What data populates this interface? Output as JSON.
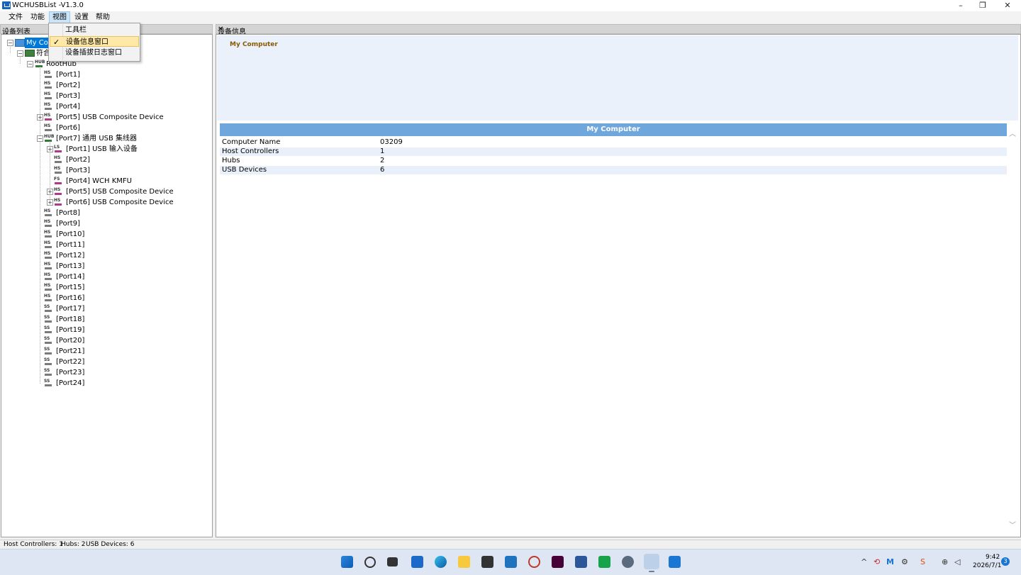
{
  "window": {
    "title": "WCHUSBList -V1.3.0"
  },
  "menu": {
    "items": [
      "文件",
      "功能",
      "视图",
      "设置",
      "帮助"
    ]
  },
  "view_menu": {
    "items": [
      {
        "label": "工具栏",
        "checked": false
      },
      {
        "label": "设备信息窗口",
        "checked": true
      },
      {
        "label": "设备插拔日志窗口",
        "checked": false
      }
    ]
  },
  "left_pane": {
    "title": "设备列表"
  },
  "tree": {
    "root": "My Com",
    "controller": "符合",
    "roothub": "RootHub",
    "ports": [
      "[Port1]",
      "[Port2]",
      "[Port3]",
      "[Port4]",
      "[Port5] USB Composite Device",
      "[Port6]",
      "[Port7] 通用 USB 集线器"
    ],
    "subports": [
      "[Port1] USB 输入设备",
      "[Port2]",
      "[Port3]",
      "[Port4] WCH KMFU",
      "[Port5] USB Composite Device",
      "[Port6] USB Composite Device"
    ],
    "more_ports": [
      "[Port8]",
      "[Port9]",
      "[Port10]",
      "[Port11]",
      "[Port12]",
      "[Port13]",
      "[Port14]",
      "[Port15]",
      "[Port16]",
      "[Port17]",
      "[Port18]",
      "[Port19]",
      "[Port20]",
      "[Port21]",
      "[Port22]",
      "[Port23]",
      "[Port24]"
    ]
  },
  "right_pane": {
    "title": "设备信息",
    "heading": "My Computer",
    "table_title": "My Computer",
    "rows": [
      {
        "key": "Computer Name",
        "value": "03209"
      },
      {
        "key": "Host Controllers",
        "value": "1"
      },
      {
        "key": "Hubs",
        "value": "2"
      },
      {
        "key": "USB Devices",
        "value": "6"
      }
    ]
  },
  "status": {
    "host_controllers": "Host Controllers: 1",
    "hubs": "Hubs: 2",
    "usb_devices": "USB Devices: 6"
  },
  "taskbar": {
    "time": "9:42",
    "date": "2026/7/1",
    "notification_count": "3"
  },
  "colors": {
    "accent": "#0078d7",
    "table_header": "#6fa7dd",
    "info_bg": "#eaf1fb",
    "selected_menu": "#ffe9a8"
  }
}
